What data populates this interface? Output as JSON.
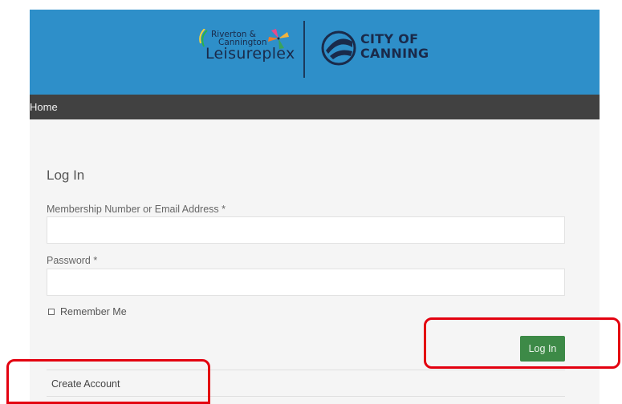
{
  "header": {
    "leisure_logo": {
      "line1": "Riverton &",
      "line2": "Cannington",
      "line3": "Leisureplex"
    },
    "city_logo": {
      "line1": "CITY OF",
      "line2": "CANNING"
    }
  },
  "nav": {
    "home_label": "Home"
  },
  "form": {
    "title": "Log In",
    "email_label": "Membership Number or Email Address *",
    "email_value": "",
    "password_label": "Password *",
    "password_value": "",
    "remember_label": "Remember Me",
    "remember_checked": false,
    "login_button": "Log In",
    "create_account": "Create Account"
  },
  "colors": {
    "header_bg": "#2e8fc9",
    "nav_bg": "#414141",
    "button_bg": "#3d8a47",
    "annotation": "#e3000f"
  },
  "icons": [
    "pinwheel-icon",
    "city-of-canning-emblem-icon",
    "checkbox-icon"
  ]
}
